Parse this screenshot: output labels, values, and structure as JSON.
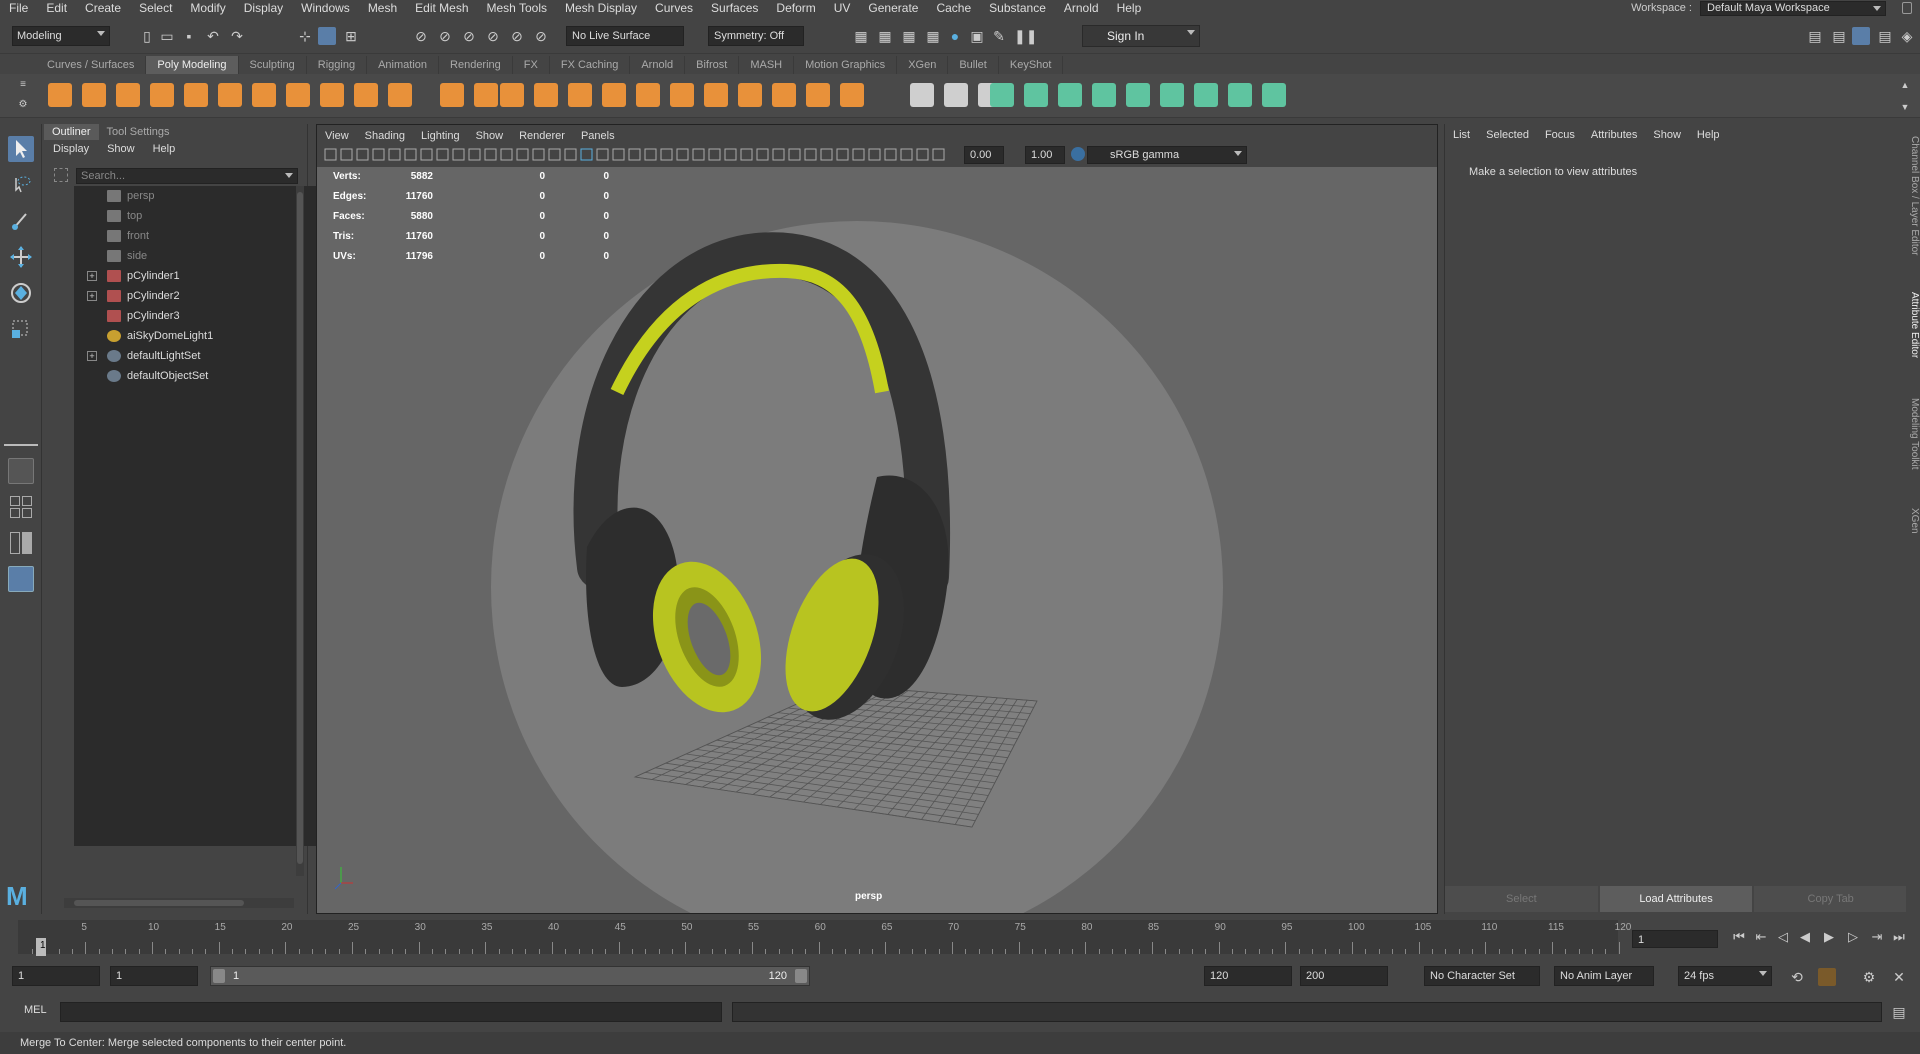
{
  "menubar": {
    "items": [
      "File",
      "Edit",
      "Create",
      "Select",
      "Modify",
      "Display",
      "Windows",
      "Mesh",
      "Edit Mesh",
      "Mesh Tools",
      "Mesh Display",
      "Curves",
      "Surfaces",
      "Deform",
      "UV",
      "Generate",
      "Cache",
      "Substance",
      "Arnold",
      "Help"
    ],
    "workspace_label": "Workspace :",
    "workspace_value": "Default Maya Workspace"
  },
  "status": {
    "mode": "Modeling",
    "live_surface": "No Live Surface",
    "symmetry": "Symmetry: Off",
    "sign_in": "Sign In"
  },
  "shelf": {
    "tabs": [
      "Curves / Surfaces",
      "Poly Modeling",
      "Sculpting",
      "Rigging",
      "Animation",
      "Rendering",
      "FX",
      "FX Caching",
      "Arnold",
      "Bifrost",
      "MASH",
      "Motion Graphics",
      "XGen",
      "Bullet",
      "KeyShot"
    ],
    "active_tab": "Poly Modeling",
    "accent": "#e8913a",
    "accent2": "#5fc4a0"
  },
  "outliner": {
    "tabs": [
      "Outliner",
      "Tool Settings"
    ],
    "menu": [
      "Display",
      "Show",
      "Help"
    ],
    "search_placeholder": "Search...",
    "items": [
      {
        "label": "persp",
        "type": "camera"
      },
      {
        "label": "top",
        "type": "camera"
      },
      {
        "label": "front",
        "type": "camera"
      },
      {
        "label": "side",
        "type": "camera"
      },
      {
        "label": "pCylinder1",
        "type": "mesh",
        "expandable": true
      },
      {
        "label": "pCylinder2",
        "type": "mesh",
        "expandable": true
      },
      {
        "label": "pCylinder3",
        "type": "mesh"
      },
      {
        "label": "aiSkyDomeLight1",
        "type": "light"
      },
      {
        "label": "defaultLightSet",
        "type": "set",
        "expandable": true
      },
      {
        "label": "defaultObjectSet",
        "type": "set"
      }
    ]
  },
  "viewport": {
    "menu": [
      "View",
      "Shading",
      "Lighting",
      "Show",
      "Renderer",
      "Panels"
    ],
    "exposure": "0.00",
    "gamma": "1.00",
    "color_space": "sRGB gamma",
    "camera": "persp",
    "hud": [
      {
        "label": "Verts:",
        "v1": "5882",
        "v2": "0",
        "v3": "0"
      },
      {
        "label": "Edges:",
        "v1": "11760",
        "v2": "0",
        "v3": "0"
      },
      {
        "label": "Faces:",
        "v1": "5880",
        "v2": "0",
        "v3": "0"
      },
      {
        "label": "Tris:",
        "v1": "11760",
        "v2": "0",
        "v3": "0"
      },
      {
        "label": "UVs:",
        "v1": "11796",
        "v2": "0",
        "v3": "0"
      }
    ]
  },
  "attribute_editor": {
    "menu": [
      "List",
      "Selected",
      "Focus",
      "Attributes",
      "Show",
      "Help"
    ],
    "message": "Make a selection to view attributes",
    "buttons": [
      "Select",
      "Load Attributes",
      "Copy Tab"
    ]
  },
  "side_tabs": [
    "Channel Box / Layer Editor",
    "Attribute Editor",
    "Modeling Toolkit",
    "XGen"
  ],
  "timeline": {
    "ticks": [
      "5",
      "10",
      "15",
      "20",
      "25",
      "30",
      "35",
      "40",
      "45",
      "50",
      "55",
      "60",
      "65",
      "70",
      "75",
      "80",
      "85",
      "90",
      "95",
      "100",
      "105",
      "110",
      "115",
      "120"
    ],
    "current_frame": "1",
    "current_field": "1"
  },
  "range": {
    "start": "1",
    "start2": "1",
    "bar_start": "1",
    "bar_end": "120",
    "end": "120",
    "end2": "200",
    "character_set": "No Character Set",
    "anim_layer": "No Anim Layer",
    "fps": "24 fps"
  },
  "command": {
    "label": "MEL"
  },
  "help_line": "Merge To Center: Merge selected components to their center point."
}
